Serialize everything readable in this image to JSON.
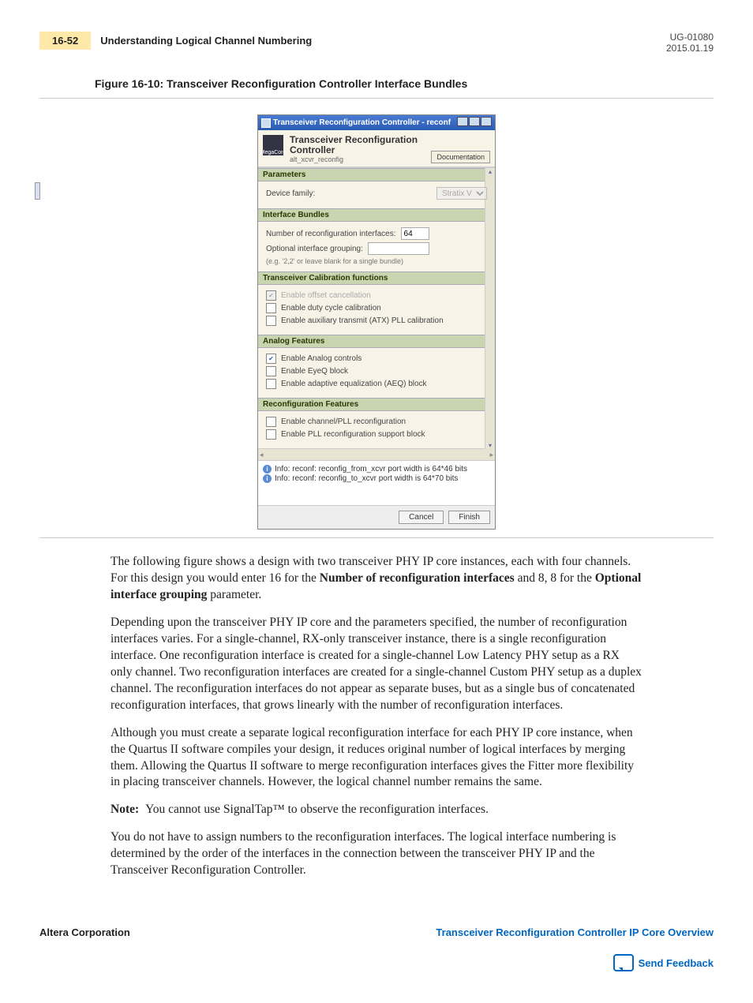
{
  "header": {
    "page_number": "16-52",
    "section_title": "Understanding Logical Channel Numbering",
    "doc_id": "UG-01080",
    "date": "2015.01.19"
  },
  "figure_caption": "Figure 16-10: Transceiver Reconfiguration Controller Interface Bundles",
  "dialog": {
    "window_title": "Transceiver Reconfiguration Controller - reconf",
    "logo_text": "MegaCore",
    "product_title": "Transceiver Reconfiguration Controller",
    "product_sub": "alt_xcvr_reconfig",
    "doc_button": "Documentation",
    "groups": {
      "parameters": {
        "header": "Parameters",
        "device_family_label": "Device family:",
        "device_family_value": "Stratix V"
      },
      "interface_bundles": {
        "header": "Interface Bundles",
        "num_if_label": "Number of reconfiguration interfaces:",
        "num_if_value": "64",
        "opt_group_label": "Optional interface grouping:",
        "opt_group_value": "",
        "hint": "(e.g. '2,2' or leave blank for a single bundle)"
      },
      "calib": {
        "header": "Transceiver Calibration functions",
        "opt1": "Enable offset cancellation",
        "opt2": "Enable duty cycle calibration",
        "opt3": "Enable auxiliary transmit (ATX) PLL calibration"
      },
      "analog": {
        "header": "Analog Features",
        "opt1": "Enable Analog controls",
        "opt2": "Enable EyeQ block",
        "opt3": "Enable adaptive equalization (AEQ) block"
      },
      "reconfig": {
        "header": "Reconfiguration Features",
        "opt1": "Enable channel/PLL reconfiguration",
        "opt2": "Enable PLL reconfiguration support block"
      }
    },
    "info1": "Info: reconf: reconfig_from_xcvr port width is 64*46 bits",
    "info2": "Info: reconf: reconfig_to_xcvr port width is 64*70 bits",
    "cancel": "Cancel",
    "finish": "Finish"
  },
  "paragraphs": {
    "p1a": "The following figure shows a design with two transceiver PHY IP core instances, each with four channels. For this design you would enter 16 for the ",
    "p1b": "Number of reconfiguration interfaces",
    "p1c": " and 8, 8 for the ",
    "p1d": "Optional interface grouping",
    "p1e": " parameter.",
    "p2": "Depending upon the transceiver PHY IP core and the parameters specified, the number of reconfiguration interfaces varies. For a single-channel, RX-only transceiver instance, there is a single reconfiguration interface. One reconfiguration interface is created for a single-channel Low Latency PHY setup as a RX only channel. Two reconfiguration interfaces are created for a single-channel Custom PHY setup as a duplex channel. The reconfiguration interfaces do not appear as separate buses, but as a single bus of concatenated reconfiguration interfaces, that grows linearly with the number of reconfiguration interfaces.",
    "p3": "Although you must create a separate logical reconfiguration interface for each PHY IP core instance, when the Quartus II software compiles your design, it reduces original number of logical interfaces by merging them. Allowing the Quartus II software to merge reconfiguration interfaces gives the Fitter more flexibility in placing transceiver channels. However, the logical channel number remains the same.",
    "note_label": "Note:",
    "note_text": "You cannot use SignalTap™ to observe the reconfiguration interfaces.",
    "p5": "You do not have to assign numbers to the reconfiguration interfaces. The logical interface numbering is determined by the order of the interfaces in the connection between the transceiver PHY IP and the Transceiver Reconfiguration Controller."
  },
  "footer": {
    "left": "Altera Corporation",
    "right": "Transceiver Reconfiguration Controller IP Core Overview",
    "feedback": "Send Feedback"
  }
}
